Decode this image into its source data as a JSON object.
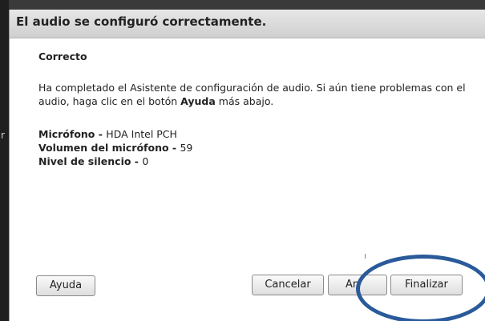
{
  "background_peek": "r",
  "dialog": {
    "title": "El audio se configuró correctamente.",
    "status": "Correcto",
    "message": {
      "part1": "Ha completado el Asistente de configuración de audio. Si aún tiene problemas con el audio, haga clic en el botón ",
      "bold_word": "Ayuda",
      "part2": " más abajo."
    },
    "info": [
      {
        "label": "Micrófono - ",
        "value": "HDA Intel PCH"
      },
      {
        "label": "Volumen del micrófono - ",
        "value": "59"
      },
      {
        "label": "Nivel de silencio - ",
        "value": "0"
      }
    ],
    "buttons": {
      "help": "Ayuda",
      "cancel": "Cancelar",
      "back": "An",
      "finish": "Finalizar"
    }
  },
  "annotation": {
    "highlight_color": "#2a5a9a",
    "highlight_target": "finish-button"
  },
  "colors": {
    "titlebar": "#d8d8d8",
    "dialog_bg": "#ffffff",
    "desktop_bg": "#3a3a3a"
  }
}
